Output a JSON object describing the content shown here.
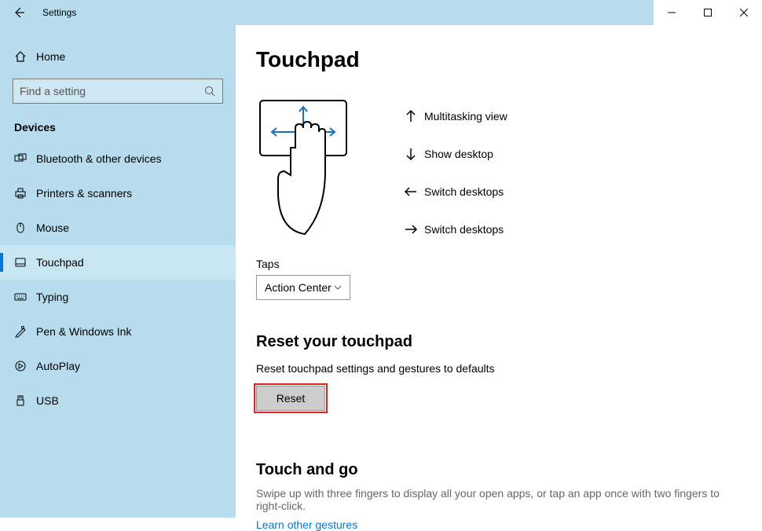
{
  "window": {
    "title": "Settings"
  },
  "sidebar": {
    "home_label": "Home",
    "search_placeholder": "Find a setting",
    "section": "Devices",
    "items": [
      {
        "icon": "bluetooth",
        "label": "Bluetooth & other devices"
      },
      {
        "icon": "printer",
        "label": "Printers & scanners"
      },
      {
        "icon": "mouse",
        "label": "Mouse"
      },
      {
        "icon": "touchpad",
        "label": "Touchpad",
        "selected": true
      },
      {
        "icon": "typing",
        "label": "Typing"
      },
      {
        "icon": "pen",
        "label": "Pen & Windows Ink"
      },
      {
        "icon": "autoplay",
        "label": "AutoPlay"
      },
      {
        "icon": "usb",
        "label": "USB"
      }
    ]
  },
  "page": {
    "title": "Touchpad",
    "gestures": [
      {
        "dir": "up",
        "label": "Multitasking view"
      },
      {
        "dir": "down",
        "label": "Show desktop"
      },
      {
        "dir": "left",
        "label": "Switch desktops"
      },
      {
        "dir": "right",
        "label": "Switch desktops"
      }
    ],
    "taps_label": "Taps",
    "taps_value": "Action Center",
    "reset_section_title": "Reset your touchpad",
    "reset_section_desc": "Reset touchpad settings and gestures to defaults",
    "reset_button": "Reset",
    "touch_go_title": "Touch and go",
    "touch_go_desc": "Swipe up with three fingers to display all your open apps, or tap an app once with two fingers to right-click.",
    "learn_link": "Learn other gestures"
  }
}
